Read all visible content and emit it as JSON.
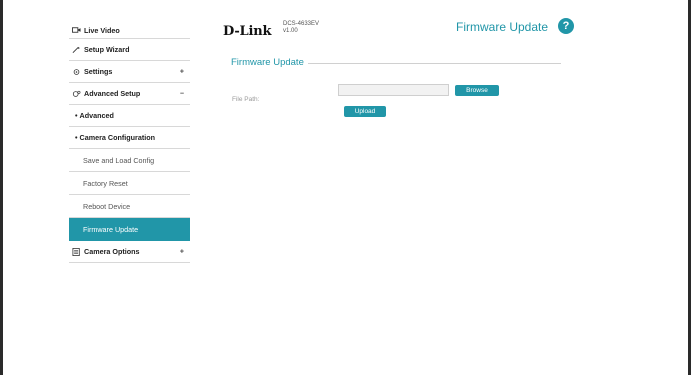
{
  "sidebar": {
    "items": [
      {
        "label": "Live Video"
      },
      {
        "label": "Setup Wizard"
      },
      {
        "label": "Settings",
        "toggle": "+"
      },
      {
        "label": "Advanced Setup",
        "toggle": "−"
      },
      {
        "label": "Advanced",
        "prefix": "•"
      },
      {
        "label": "Camera Configuration",
        "prefix": "•"
      },
      {
        "label": "Save and Load Config"
      },
      {
        "label": "Factory Reset"
      },
      {
        "label": "Reboot Device"
      },
      {
        "label": "Firmware Update"
      },
      {
        "label": "Camera Options",
        "toggle": "+"
      }
    ]
  },
  "header": {
    "logo": "D-Link",
    "model": "DCS-4633EV",
    "version": "v1.00",
    "title": "Firmware Update",
    "help": "?"
  },
  "main": {
    "section_title": "Firmware Update",
    "file_path_label": "File Path:",
    "file_path_value": "",
    "browse_label": "Browse",
    "upload_label": "Upload"
  },
  "colors": {
    "accent": "#2196a8"
  }
}
